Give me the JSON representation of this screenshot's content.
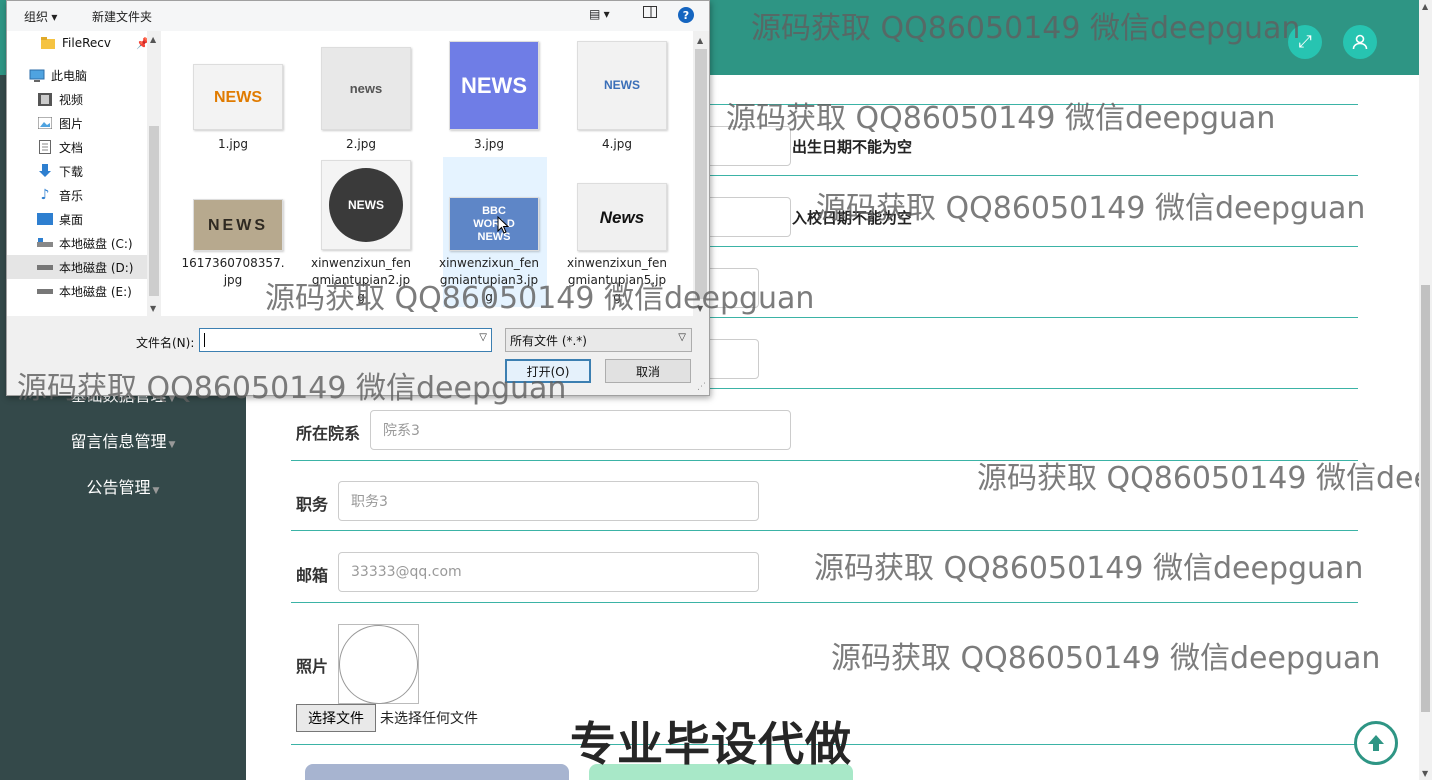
{
  "dialog": {
    "toolbar": {
      "organize": "组织 ▾",
      "new_folder": "新建文件夹"
    },
    "nav": [
      {
        "label": "FileRecv",
        "icon": "folder-icon"
      },
      {
        "label": "此电脑",
        "icon": "computer-icon"
      },
      {
        "label": "视频",
        "icon": "video-icon"
      },
      {
        "label": "图片",
        "icon": "pictures-icon"
      },
      {
        "label": "文档",
        "icon": "documents-icon"
      },
      {
        "label": "下载",
        "icon": "download-icon"
      },
      {
        "label": "音乐",
        "icon": "music-icon"
      },
      {
        "label": "桌面",
        "icon": "desktop-icon"
      },
      {
        "label": "本地磁盘 (C:)",
        "icon": "drive-icon"
      },
      {
        "label": "本地磁盘 (D:)",
        "icon": "drive-icon"
      },
      {
        "label": "本地磁盘 (E:)",
        "icon": "drive-icon"
      }
    ],
    "files": [
      {
        "name": "1.jpg",
        "thumb": "NEWS"
      },
      {
        "name": "2.jpg",
        "thumb": "news"
      },
      {
        "name": "3.jpg",
        "thumb": "NEWS"
      },
      {
        "name": "4.jpg",
        "thumb": "NEWS"
      },
      {
        "name": "1617360708357.jpg",
        "thumb": "NEWS"
      },
      {
        "name": "xinwenzixun_fengmiantupian2.jpg",
        "thumb": "NEWS"
      },
      {
        "name": "xinwenzixun_fengmiantupian3.jpg",
        "thumb": "BBC WORLD NEWS"
      },
      {
        "name": "xinwenzixun_fengmiantupian5.jpg",
        "thumb": "News"
      }
    ],
    "file_name_label": "文件名(N):",
    "file_name_value": "",
    "file_type": "所有文件 (*.*)",
    "open_label": "打开(O)",
    "cancel_label": "取消"
  },
  "sidebar": {
    "items": [
      {
        "label": "基础数据管理"
      },
      {
        "label": "留言信息管理"
      },
      {
        "label": "公告管理"
      }
    ]
  },
  "form": {
    "errors": {
      "birth": "出生日期不能为空",
      "enroll": "入校日期不能为空"
    },
    "dept_label": "所在院系",
    "dept_value": "院系3",
    "position_label": "职务",
    "position_value": "职务3",
    "email_label": "邮箱",
    "email_value": "33333@qq.com",
    "photo_label": "照片",
    "choose_file": "选择文件",
    "no_file": "未选择任何文件"
  },
  "watermark": "源码获取 QQ86050149 微信deepguan",
  "ad_text": "专业毕设代做",
  "colors": {
    "header": "#2e9584",
    "sidebar": "#34494a",
    "accent": "#27c4b1"
  }
}
